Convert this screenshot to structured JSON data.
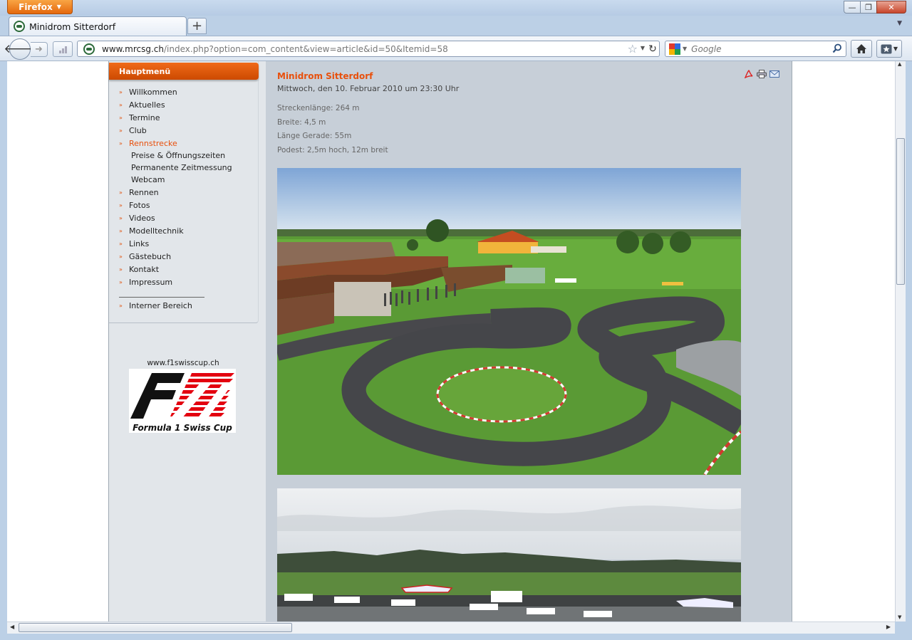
{
  "browser": {
    "app_button": "Firefox",
    "tab_title": "Minidrom Sitterdorf",
    "url_domain": "www.mrcsg.ch",
    "url_path": "/index.php?option=com_content&view=article&id=50&Itemid=58",
    "search_placeholder": "Google",
    "new_tab_label": "+"
  },
  "menu": {
    "header": "Hauptmenü",
    "items": [
      {
        "label": "Willkommen"
      },
      {
        "label": "Aktuelles"
      },
      {
        "label": "Termine"
      },
      {
        "label": "Club"
      },
      {
        "label": "Rennstrecke",
        "active": true
      },
      {
        "label": "Rennen"
      },
      {
        "label": "Fotos"
      },
      {
        "label": "Videos"
      },
      {
        "label": "Modelltechnik"
      },
      {
        "label": "Links"
      },
      {
        "label": "Gästebuch"
      },
      {
        "label": "Kontakt"
      },
      {
        "label": "Impressum"
      }
    ],
    "subitems": [
      {
        "label": "Preise & Öffnungszeiten"
      },
      {
        "label": "Permanente Zeitmessung"
      },
      {
        "label": "Webcam"
      }
    ],
    "internal": "Interner Bereich",
    "bullet": "»"
  },
  "sponsor": {
    "url": "www.f1swisscup.ch",
    "logo_text": "Formula 1 Swiss Cup"
  },
  "article": {
    "title": "Minidrom Sitterdorf",
    "date": "Mittwoch, den 10. Februar 2010 um 23:30 Uhr",
    "facts": [
      "Streckenlänge: 264 m",
      "Breite: 4,5 m",
      "Länge Gerade: 55m",
      "Podest: 2,5m hoch, 12m breit"
    ]
  },
  "colors": {
    "accent_orange": "#e8500c",
    "content_bg": "#c7cfd8",
    "sidebar_bg": "#e2e6ea"
  }
}
